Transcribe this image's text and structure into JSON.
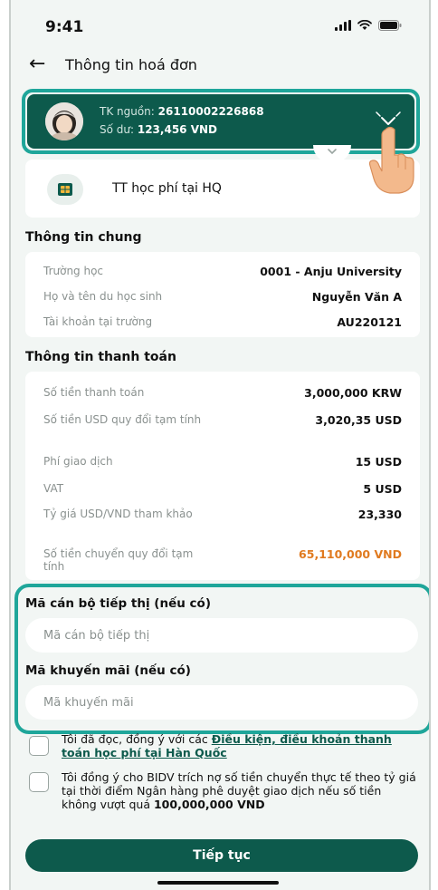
{
  "status_bar": {
    "time": "9:41"
  },
  "header": {
    "title": "Thông tin hoá đơn"
  },
  "account": {
    "source_label": "TK nguồn: ",
    "source_value": "26110002226868",
    "balance_label": "Số dư: ",
    "balance_value": "123,456 VND"
  },
  "service": {
    "label": "TT học phí tại HQ"
  },
  "general_info": {
    "title": "Thông tin chung",
    "rows": [
      {
        "label": "Trường học",
        "value": "0001 - Anju University"
      },
      {
        "label": "Họ và tên du học sinh",
        "value": "Nguyễn Văn A"
      },
      {
        "label": "Tài khoản tại trường",
        "value": "AU220121"
      }
    ]
  },
  "payment_info": {
    "title": "Thông tin thanh toán",
    "rows": [
      {
        "label": "Số tiền thanh toán",
        "value": "3,000,000 KRW"
      },
      {
        "label": "Số tiền USD quy đổi tạm tính",
        "value": "3,020,35 USD"
      },
      {
        "label": "Phí giao dịch",
        "value": "15 USD"
      },
      {
        "label": "VAT",
        "value": "5 USD"
      },
      {
        "label": "Tỷ giá USD/VND tham khảo",
        "value": "23,330"
      },
      {
        "label": "Số tiền chuyển quy đổi tạm tính",
        "value": "65,110,000 VND"
      }
    ]
  },
  "marketing": {
    "label": "Mã cán bộ tiếp thị (nếu có)",
    "placeholder": "Mã cán bộ tiếp thị"
  },
  "promo": {
    "label": "Mã khuyến mãi (nếu có)",
    "placeholder": "Mã khuyến mãi"
  },
  "terms": {
    "prefix": "Tôi đã đọc, đồng ý với các ",
    "link": "Điều kiện, điều khoản thanh toán học phí tại Hàn Quốc"
  },
  "consent": {
    "text": "Tôi đồng ý cho BIDV trích nợ số tiền chuyển thực tế theo tỷ giá tại thời điểm Ngân hàng phê duyệt giao dịch nếu số tiền không vượt quá ",
    "amount": "100,000,000 VND"
  },
  "actions": {
    "continue_label": "Tiếp tục"
  },
  "colors": {
    "primary": "#0d5a4c",
    "highlight": "#1fa69a",
    "accent_orange": "#e07a1f",
    "background": "#f2f6f4"
  },
  "icons": {
    "signal": "signal-icon",
    "wifi": "wifi-icon",
    "battery": "battery-icon",
    "back": "back-arrow-icon",
    "expand": "chevron-down-icon",
    "service": "school-card-icon",
    "pointer": "hand-pointer-icon"
  }
}
